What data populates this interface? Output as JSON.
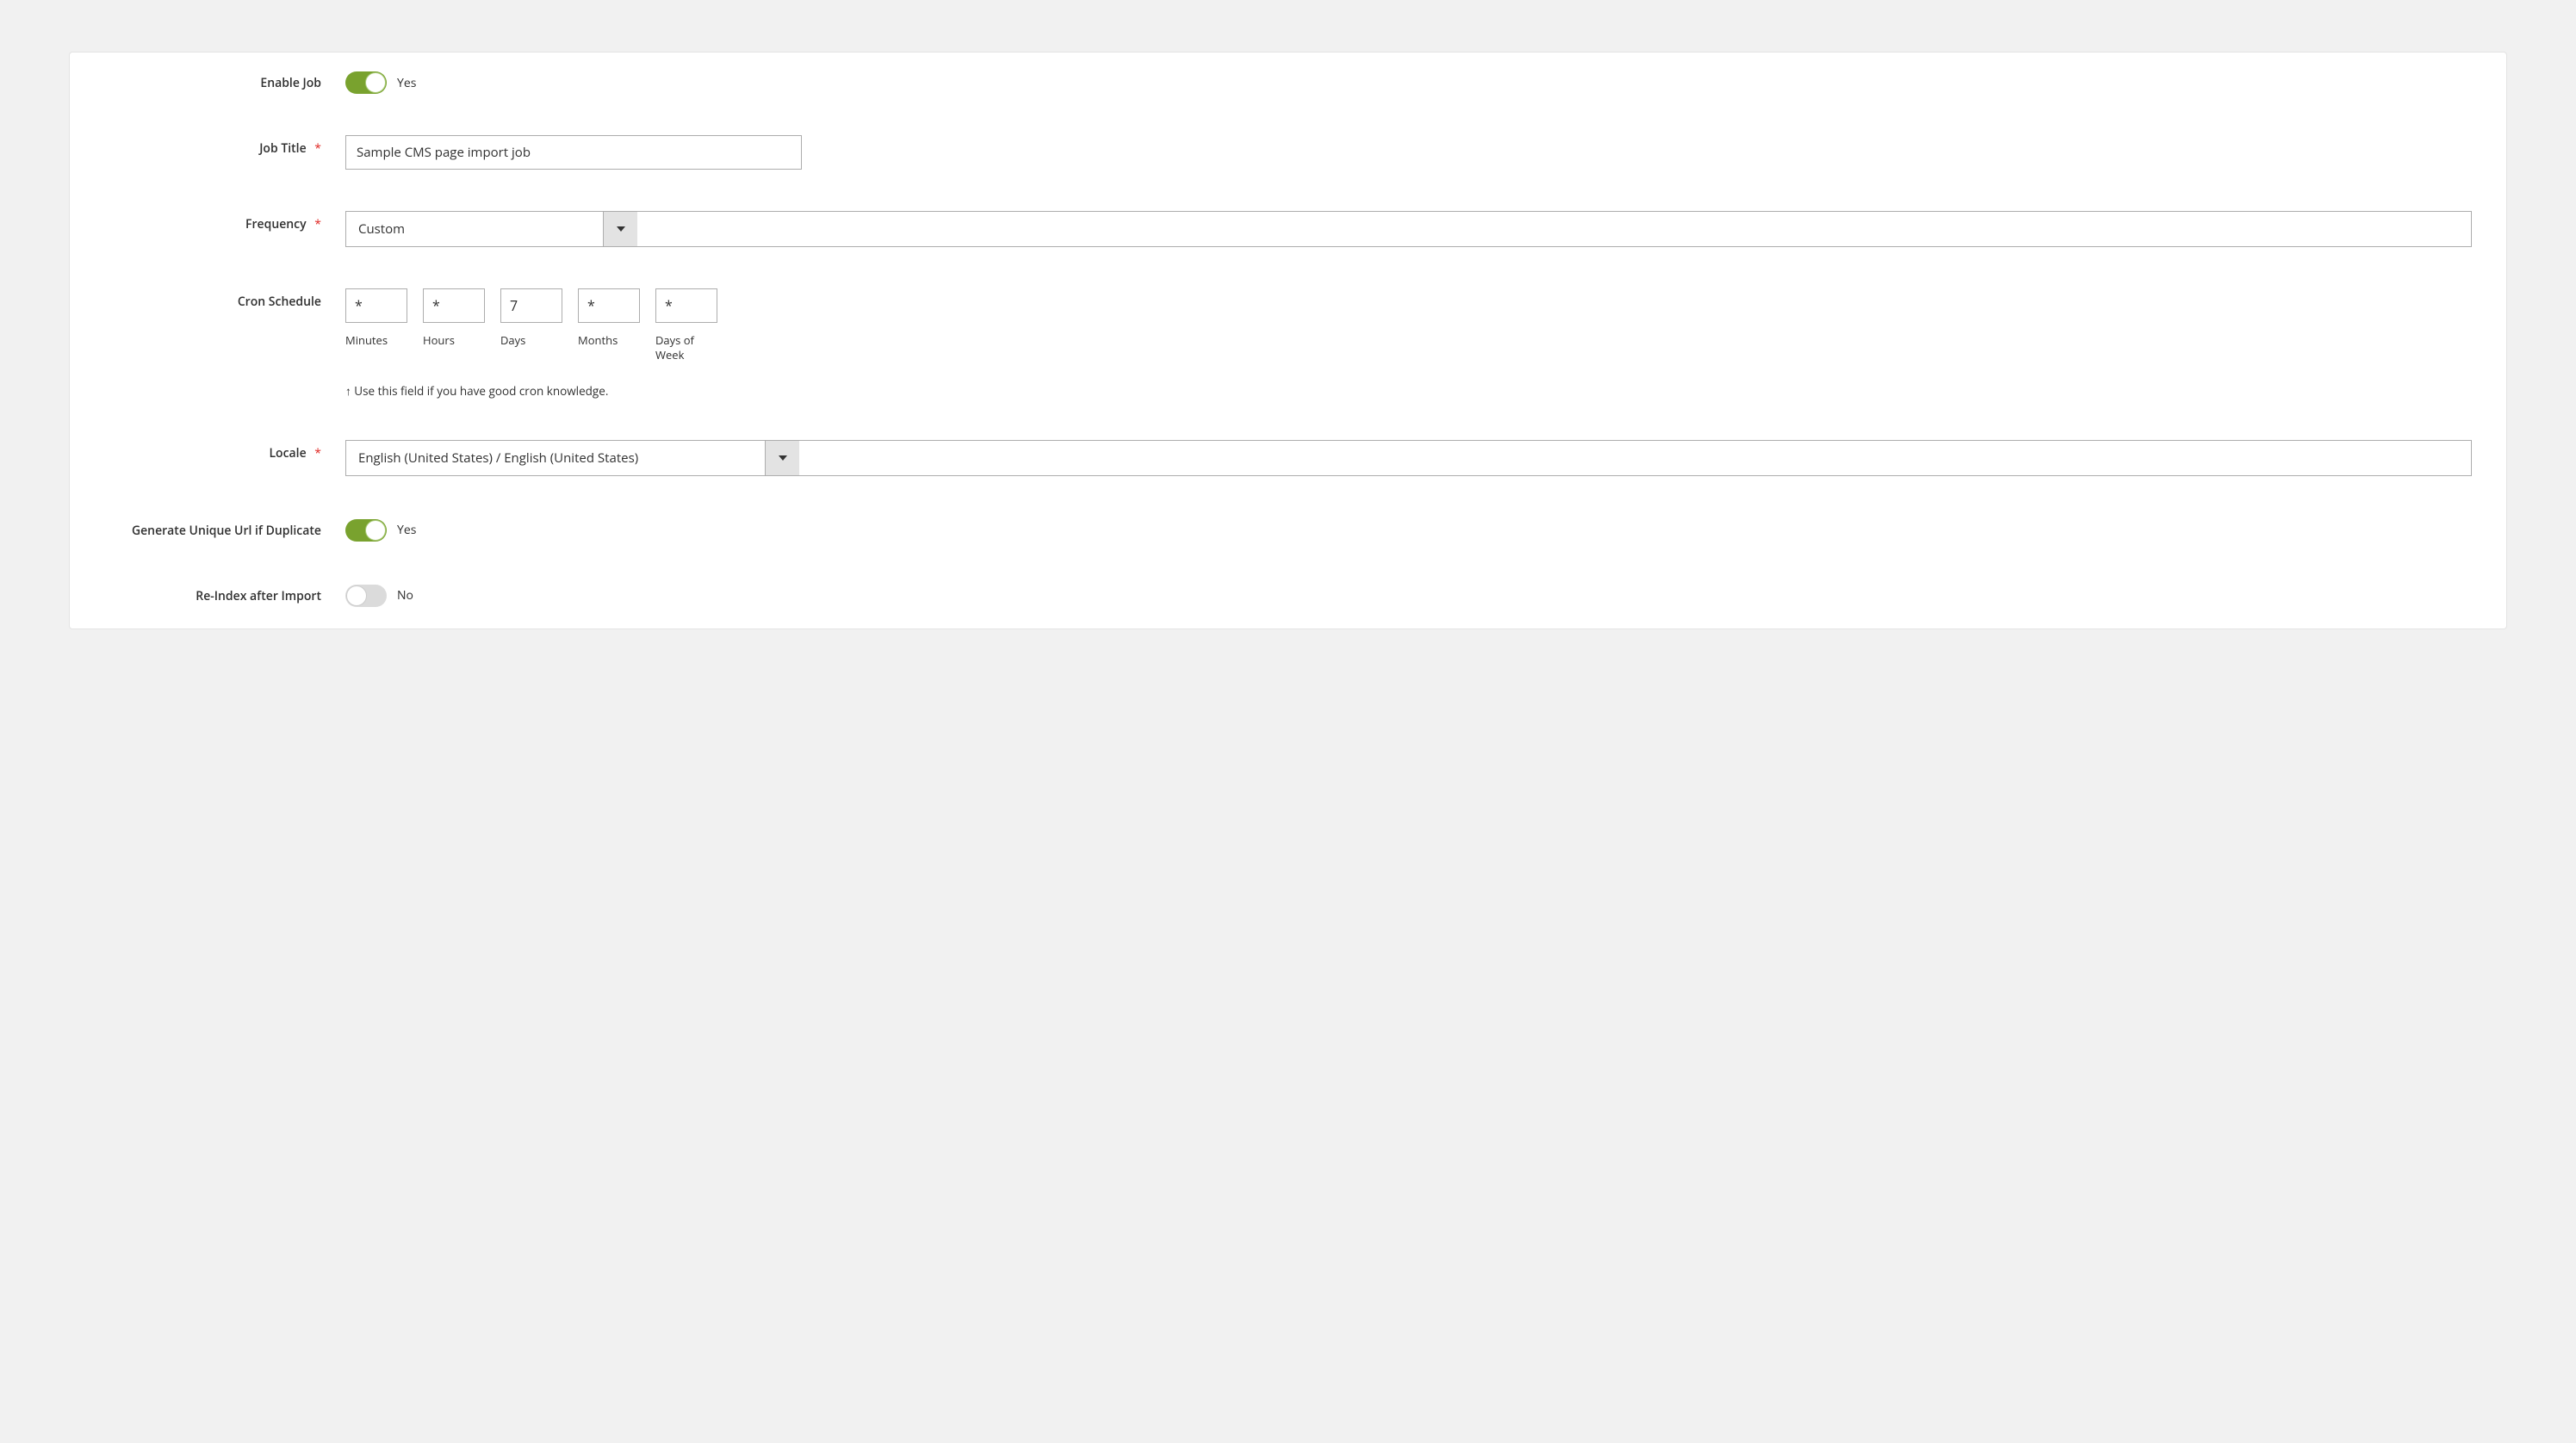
{
  "fields": {
    "enable_job": {
      "label": "Enable Job",
      "state_text": "Yes",
      "on": true
    },
    "job_title": {
      "label": "Job Title",
      "required": true,
      "value": "Sample CMS page import job"
    },
    "frequency": {
      "label": "Frequency",
      "required": true,
      "value": "Custom"
    },
    "cron": {
      "label": "Cron Schedule",
      "minutes": {
        "value": "*",
        "sub": "Minutes"
      },
      "hours": {
        "value": "*",
        "sub": "Hours"
      },
      "days": {
        "value": "7",
        "sub": "Days"
      },
      "months": {
        "value": "*",
        "sub": "Months"
      },
      "dow": {
        "value": "*",
        "sub": "Days of Week"
      },
      "hint": "↑ Use this field if you have good cron knowledge."
    },
    "locale": {
      "label": "Locale",
      "required": true,
      "value": "English (United States) / English (United States)"
    },
    "unique_url": {
      "label": "Generate Unique Url if Dupli­cate",
      "state_text": "Yes",
      "on": true
    },
    "reindex": {
      "label": "Re-Index after Import",
      "state_text": "No",
      "on": false
    }
  }
}
